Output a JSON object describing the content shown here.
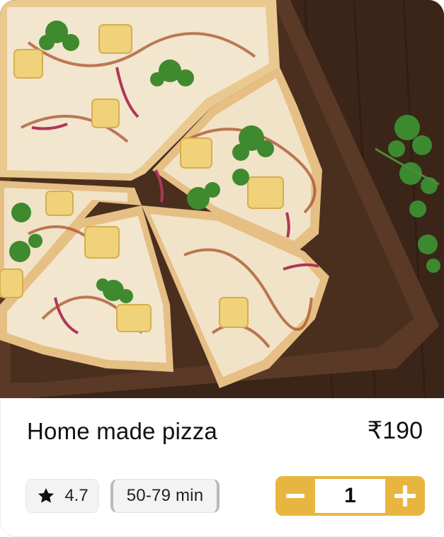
{
  "item": {
    "title": "Home made pizza",
    "price": "₹190",
    "rating": "4.7",
    "delivery_time": "50-79 min",
    "quantity": "1"
  },
  "icons": {
    "rating": "star-icon",
    "decrement": "minus-icon",
    "increment": "plus-icon"
  },
  "colors": {
    "accent": "#e8b640",
    "chip_bg": "#f3f3f3",
    "text": "#111111"
  }
}
